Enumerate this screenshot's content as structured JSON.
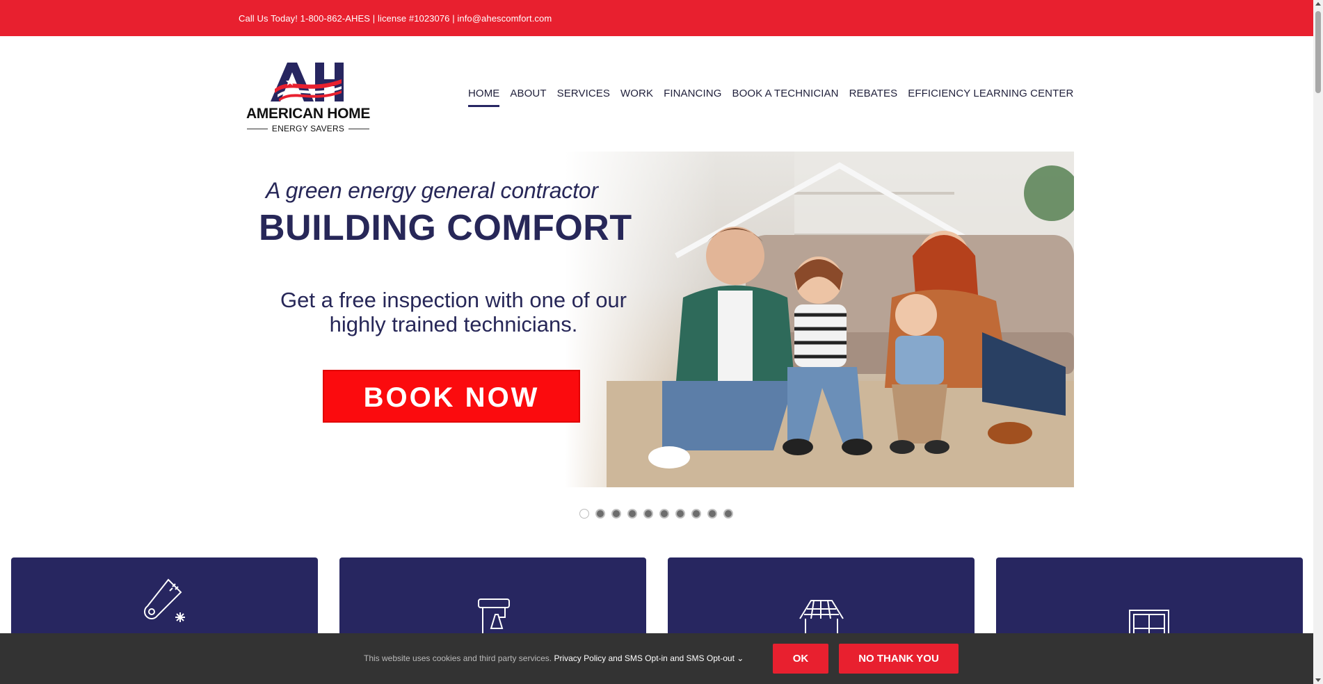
{
  "topbar": {
    "text": "Call Us Today! 1-800-862-AHES | license #1023076 | info@ahescomfort.com"
  },
  "logo": {
    "name": "AMERICAN HOME",
    "sub": "ENERGY SAVERS",
    "mark": "AH"
  },
  "nav": {
    "items": [
      {
        "label": "HOME",
        "active": true
      },
      {
        "label": "ABOUT"
      },
      {
        "label": "SERVICES"
      },
      {
        "label": "WORK"
      },
      {
        "label": "FINANCING"
      },
      {
        "label": "BOOK A TECHNICIAN"
      },
      {
        "label": "REBATES"
      },
      {
        "label": "EFFICIENCY LEARNING CENTER"
      }
    ]
  },
  "hero": {
    "tagline": "A green energy general contractor",
    "headline": "BUILDING COMFORT",
    "offer_line1": "Get a free inspection with one of our",
    "offer_line2": "highly trained technicians.",
    "button": "BOOK NOW"
  },
  "slider": {
    "count": 10,
    "current": 1
  },
  "cards": [
    {
      "icon": "thermometer-snowflake-icon"
    },
    {
      "icon": "faucet-icon"
    },
    {
      "icon": "house-roof-icon"
    },
    {
      "icon": "window-icon"
    }
  ],
  "cookie": {
    "message": "This website uses cookies and third party services.",
    "policy_link": "Privacy Policy and SMS Opt-in and SMS Opt-out",
    "ok_label": "OK",
    "no_label": "NO THANK YOU"
  },
  "colors": {
    "brand_red": "#e8202f",
    "brand_navy": "#272660",
    "cookie_bg": "#333333"
  }
}
